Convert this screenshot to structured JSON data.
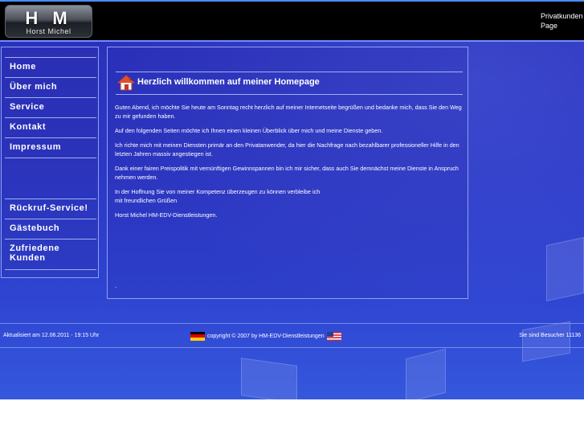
{
  "header": {
    "logo_letters": "H M",
    "logo_name": "Horst Michel",
    "link_text": "Privatkunden Page"
  },
  "sidebar": {
    "items": [
      {
        "label": "Home"
      },
      {
        "label": "Über mich"
      },
      {
        "label": "Service"
      },
      {
        "label": "Kontakt"
      },
      {
        "label": "Impressum"
      },
      {
        "label": "Rückruf-Service!"
      },
      {
        "label": "Gästebuch"
      },
      {
        "label": "Zufriedene Kunden"
      }
    ]
  },
  "content": {
    "icon": "home-icon",
    "title": "Herzlich willkommen auf meiner Homepage",
    "paragraphs": [
      "Guten Abend, ich möchte Sie heute am Sonntag recht herzlich auf meiner Internetseite begrüßen und bedanke mich, dass Sie den Weg zu mir gefunden haben.",
      "Auf den folgenden Seiten möchte ich Ihnen einen kleinen Überblick über mich und meine Dienste geben.",
      "Ich richte mich mit meinen Diensten primär an den Privatanwender, da hier die Nachfrage nach bezahlbarer professioneller Hilfe in den letzten Jahren massiv angestiegen ist.",
      "Dank einer fairen Preispolitik mit vernünftigen Gewinnspannen bin ich mir sicher, dass auch Sie demnächst meine Dienste in Anspruch nehmen werden.",
      "In der Hoffnung Sie von meiner Kompetenz überzeugen zu können verbleibe ich",
      "mit freundlichen Grüßen",
      "Horst Michel HM-EDV-Dienstleistungen."
    ],
    "trailing": "."
  },
  "footer": {
    "updated": "Aktualisiert am 12.06.2011 - 19:15 Uhr",
    "copyright": "copyright © 2007 by HM-EDV-Dienstleistungen",
    "visitors": "Sie sind Besucher 11136",
    "flag_left": "germany-flag-icon",
    "flag_right": "usa-flag-icon"
  },
  "colors": {
    "background": "#2c37c4",
    "header": "#000000",
    "border": "#8da2f0",
    "text": "#ffffff"
  }
}
